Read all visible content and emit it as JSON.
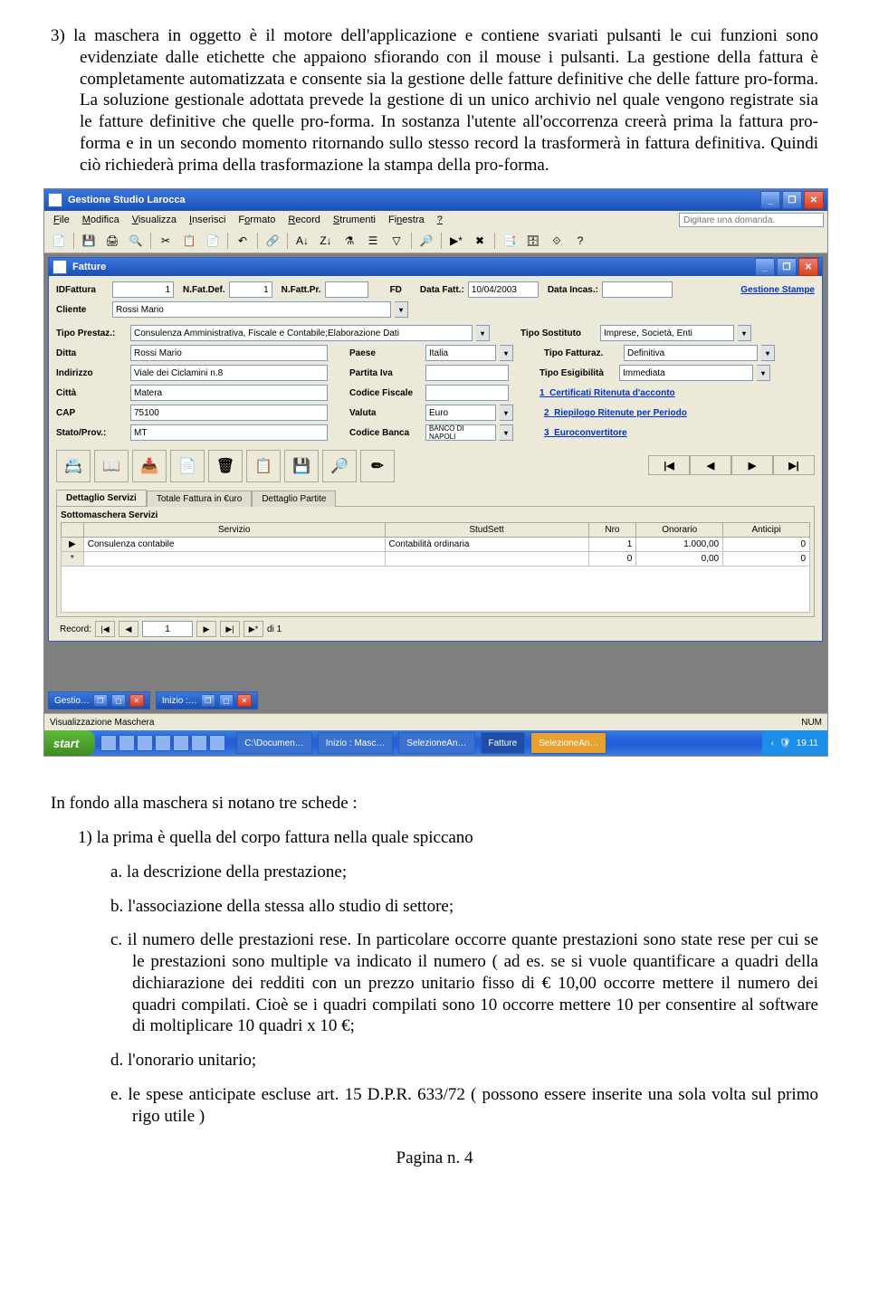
{
  "doc": {
    "para1": "3) la maschera in oggetto è il motore dell'applicazione e contiene svariati pulsanti le cui funzioni sono evidenziate dalle etichette che appaiono sfiorando con il mouse i pulsanti. La gestione della fattura è completamente automatizzata e consente sia la gestione delle fatture definitive che delle fatture pro-forma. La soluzione gestionale adottata prevede la gestione di un unico archivio nel quale vengono registrate sia le fatture definitive che quelle pro-forma. In sostanza l'utente all'occorrenza creerà prima la fattura pro-forma e in un secondo momento ritornando sullo stesso record la trasformerà in fattura definitiva. Quindi ciò richiederà prima della trasformazione la stampa della pro-forma.",
    "para2": "In fondo alla maschera si notano tre schede :",
    "li1": "1)  la prima è quella del corpo fattura nella quale spiccano",
    "la": "a.   la descrizione della prestazione;",
    "lb": "b.   l'associazione della stessa allo studio di settore;",
    "lc": "c.   il numero delle prestazioni rese. In particolare occorre quante prestazioni sono state rese per cui se le prestazioni sono multiple va indicato il numero ( ad es. se si vuole quantificare a quadri della dichiarazione dei redditi con un prezzo unitario fisso di € 10,00  occorre mettere il numero dei quadri compilati. Cioè se i quadri compilati sono 10 occorre mettere 10 per consentire al software di moltiplicare 10 quadri x 10 €;",
    "ld": "d.   l'onorario unitario;",
    "le": "e.   le spese anticipate escluse art. 15 D.P.R. 633/72 ( possono essere inserite una sola volta sul primo rigo utile )",
    "footer": "Pagina n. 4"
  },
  "app": {
    "title": "Gestione Studio Larocca",
    "menu": [
      "File",
      "Modifica",
      "Visualizza",
      "Inserisci",
      "Formato",
      "Record",
      "Strumenti",
      "Finestra",
      "?"
    ],
    "search_placeholder": "Digitare una domanda.",
    "status_left": "Visualizzazione Maschera",
    "status_right": "NUM"
  },
  "inner": {
    "title": "Fatture",
    "labels": {
      "idfat": "IDFattura",
      "nfatdef": "N.Fat.Def.",
      "nfatpr": "N.Fatt.Pr.",
      "fd": "FD",
      "datafat": "Data Fatt.:",
      "dataincas": "Data Incas.:",
      "cli": "Cliente",
      "tipoprest": "Tipo Prestaz.:",
      "tiposost": "Tipo Sostituto",
      "ditta": "Ditta",
      "paese": "Paese",
      "tipofatt": "Tipo Fatturaz.",
      "indir": "Indirizzo",
      "piva": "Partita Iva",
      "tipoesig": "Tipo Esigibilità",
      "citta": "Città",
      "cf": "Codice Fiscale",
      "cap": "CAP",
      "valuta": "Valuta",
      "stato": "Stato/Prov.:",
      "banca": "Codice Banca",
      "gest": "Gestione Stampe"
    },
    "vals": {
      "idfat": "1",
      "nfatdef": "1",
      "nfatpr": "",
      "datafat": "10/04/2003",
      "dataincas": "",
      "cli": "Rossi Mario",
      "tipoprest": "Consulenza Amministrativa, Fiscale e Contabile;Elaborazione Dati",
      "tiposost": "Imprese, Società, Enti",
      "ditta": "Rossi Mario",
      "paese": "Italia",
      "tipofatt": "Definitiva",
      "indir": "Viale dei Ciclamini n.8",
      "piva": "",
      "tipoesig": "Immediata",
      "citta": "Matera",
      "cf": "",
      "cap": "75100",
      "valuta": "Euro",
      "stato": "MT",
      "banca": "BANCO DI NAPOLI"
    },
    "links": {
      "l1": "1_Certificati Ritenuta d'acconto",
      "l2": "2_Riepilogo Ritenute per Periodo",
      "l3": "3_Euroconvertitore"
    },
    "tabs": [
      "Dettaglio Servizi",
      "Totale Fattura in €uro",
      "Dettaglio Partite"
    ],
    "subhdr": "Sottomaschera Servizi",
    "cols": [
      "Servizio",
      "StudSett",
      "Nro",
      "Onorario",
      "Anticipi"
    ],
    "rows": [
      {
        "serv": "Consulenza contabile",
        "stud": "Contabilità ordinaria",
        "nro": "1",
        "ono": "1.000,00",
        "ant": "0"
      },
      {
        "serv": "",
        "stud": "",
        "nro": "0",
        "ono": "0,00",
        "ant": "0"
      }
    ],
    "rec": {
      "label": "Record:",
      "pos": "1",
      "of": "di 1"
    }
  },
  "mdi": {
    "c1": "Gestio…",
    "c2": "Inizio :…"
  },
  "taskbar": {
    "start": "start",
    "items": [
      "C:\\Documen…",
      "Inizio : Masc…",
      "SelezioneAn…",
      "Fatture",
      "SelezioneAn…"
    ],
    "time": "19.11"
  }
}
